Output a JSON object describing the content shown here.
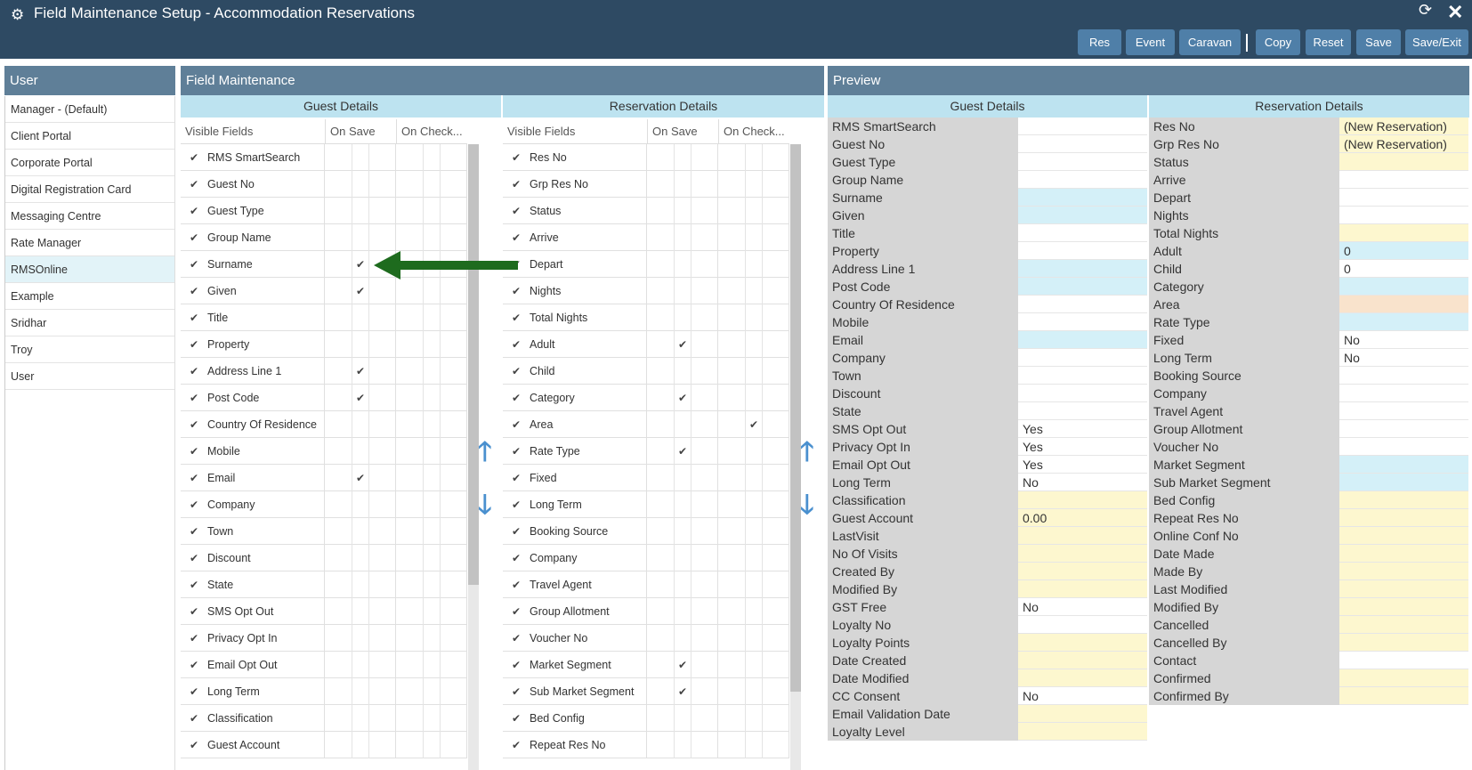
{
  "window": {
    "title": "Field Maintenance Setup - Accommodation Reservations",
    "icon": "gears-icon",
    "refresh_icon": "refresh-icon",
    "close_icon": "close-icon"
  },
  "toolbar": {
    "res": "Res",
    "event": "Event",
    "caravan": "Caravan",
    "copy": "Copy",
    "reset": "Reset",
    "save": "Save",
    "save_exit": "Save/Exit"
  },
  "user_panel": {
    "title": "User",
    "items": [
      "Manager - (Default)",
      "Client Portal",
      "Corporate Portal",
      "Digital Registration Card",
      "Messaging Centre",
      "Rate Manager",
      "RMSOnline",
      "Example",
      "Sridhar",
      "Troy",
      "User"
    ],
    "selected": "RMSOnline"
  },
  "field_maintenance": {
    "title": "Field Maintenance",
    "guest": {
      "title": "Guest Details",
      "col_visible": "Visible Fields",
      "col_on_save": "On Save",
      "col_on_checkin": "On Check...",
      "rows": [
        {
          "name": "RMS SmartSearch",
          "visible": true,
          "save": false,
          "checkin": false
        },
        {
          "name": "Guest No",
          "visible": true,
          "save": false,
          "checkin": false
        },
        {
          "name": "Guest Type",
          "visible": true,
          "save": false,
          "checkin": false
        },
        {
          "name": "Group Name",
          "visible": true,
          "save": false,
          "checkin": false
        },
        {
          "name": "Surname",
          "visible": true,
          "save": true,
          "checkin": false
        },
        {
          "name": "Given",
          "visible": true,
          "save": true,
          "checkin": false
        },
        {
          "name": "Title",
          "visible": true,
          "save": false,
          "checkin": false
        },
        {
          "name": "Property",
          "visible": true,
          "save": false,
          "checkin": false
        },
        {
          "name": "Address Line 1",
          "visible": true,
          "save": true,
          "checkin": false
        },
        {
          "name": "Post Code",
          "visible": true,
          "save": true,
          "checkin": false
        },
        {
          "name": "Country Of Residence",
          "visible": true,
          "save": false,
          "checkin": false
        },
        {
          "name": "Mobile",
          "visible": true,
          "save": false,
          "checkin": false
        },
        {
          "name": "Email",
          "visible": true,
          "save": true,
          "checkin": false
        },
        {
          "name": "Company",
          "visible": true,
          "save": false,
          "checkin": false
        },
        {
          "name": "Town",
          "visible": true,
          "save": false,
          "checkin": false
        },
        {
          "name": "Discount",
          "visible": true,
          "save": false,
          "checkin": false
        },
        {
          "name": "State",
          "visible": true,
          "save": false,
          "checkin": false
        },
        {
          "name": "SMS Opt Out",
          "visible": true,
          "save": false,
          "checkin": false
        },
        {
          "name": "Privacy Opt In",
          "visible": true,
          "save": false,
          "checkin": false
        },
        {
          "name": "Email Opt Out",
          "visible": true,
          "save": false,
          "checkin": false
        },
        {
          "name": "Long Term",
          "visible": true,
          "save": false,
          "checkin": false
        },
        {
          "name": "Classification",
          "visible": true,
          "save": false,
          "checkin": false
        },
        {
          "name": "Guest Account",
          "visible": true,
          "save": false,
          "checkin": false
        }
      ]
    },
    "reservation": {
      "title": "Reservation Details",
      "col_visible": "Visible Fields",
      "col_on_save": "On Save",
      "col_on_checkin": "On Check...",
      "rows": [
        {
          "name": "Res No",
          "visible": true,
          "save": false,
          "checkin": false
        },
        {
          "name": "Grp Res No",
          "visible": true,
          "save": false,
          "checkin": false
        },
        {
          "name": "Status",
          "visible": true,
          "save": false,
          "checkin": false
        },
        {
          "name": "Arrive",
          "visible": true,
          "save": false,
          "checkin": false
        },
        {
          "name": "Depart",
          "visible": true,
          "save": false,
          "checkin": false
        },
        {
          "name": "Nights",
          "visible": true,
          "save": false,
          "checkin": false
        },
        {
          "name": "Total Nights",
          "visible": true,
          "save": false,
          "checkin": false
        },
        {
          "name": "Adult",
          "visible": true,
          "save": true,
          "checkin": false
        },
        {
          "name": "Child",
          "visible": true,
          "save": false,
          "checkin": false
        },
        {
          "name": "Category",
          "visible": true,
          "save": true,
          "checkin": false
        },
        {
          "name": "Area",
          "visible": true,
          "save": false,
          "checkin": true
        },
        {
          "name": "Rate Type",
          "visible": true,
          "save": true,
          "checkin": false
        },
        {
          "name": "Fixed",
          "visible": true,
          "save": false,
          "checkin": false
        },
        {
          "name": "Long Term",
          "visible": true,
          "save": false,
          "checkin": false
        },
        {
          "name": "Booking Source",
          "visible": true,
          "save": false,
          "checkin": false
        },
        {
          "name": "Company",
          "visible": true,
          "save": false,
          "checkin": false
        },
        {
          "name": "Travel Agent",
          "visible": true,
          "save": false,
          "checkin": false
        },
        {
          "name": "Group Allotment",
          "visible": true,
          "save": false,
          "checkin": false
        },
        {
          "name": "Voucher No",
          "visible": true,
          "save": false,
          "checkin": false
        },
        {
          "name": "Market Segment",
          "visible": true,
          "save": true,
          "checkin": false
        },
        {
          "name": "Sub Market Segment",
          "visible": true,
          "save": true,
          "checkin": false
        },
        {
          "name": "Bed Config",
          "visible": true,
          "save": false,
          "checkin": false
        },
        {
          "name": "Repeat Res No",
          "visible": true,
          "save": false,
          "checkin": false
        }
      ]
    }
  },
  "preview": {
    "title": "Preview",
    "guest": {
      "title": "Guest Details",
      "rows": [
        {
          "label": "RMS SmartSearch",
          "value": "",
          "color": "#ffffff"
        },
        {
          "label": "Guest No",
          "value": "",
          "color": "#ffffff"
        },
        {
          "label": "Guest Type",
          "value": "",
          "color": "#ffffff"
        },
        {
          "label": "Group Name",
          "value": "",
          "color": "#ffffff"
        },
        {
          "label": "Surname",
          "value": "",
          "color": "#d4f0f8"
        },
        {
          "label": "Given",
          "value": "",
          "color": "#d4f0f8"
        },
        {
          "label": "Title",
          "value": "",
          "color": "#ffffff"
        },
        {
          "label": "Property",
          "value": "",
          "color": "#ffffff"
        },
        {
          "label": "Address Line 1",
          "value": "",
          "color": "#d4f0f8"
        },
        {
          "label": "Post Code",
          "value": "",
          "color": "#d4f0f8"
        },
        {
          "label": "Country Of Residence",
          "value": "",
          "color": "#ffffff"
        },
        {
          "label": "Mobile",
          "value": "",
          "color": "#ffffff"
        },
        {
          "label": "Email",
          "value": "",
          "color": "#d4f0f8"
        },
        {
          "label": "Company",
          "value": "",
          "color": "#ffffff"
        },
        {
          "label": "Town",
          "value": "",
          "color": "#ffffff"
        },
        {
          "label": "Discount",
          "value": "",
          "color": "#ffffff"
        },
        {
          "label": "State",
          "value": "",
          "color": "#ffffff"
        },
        {
          "label": "SMS Opt Out",
          "value": "Yes",
          "color": "#ffffff"
        },
        {
          "label": "Privacy Opt In",
          "value": "Yes",
          "color": "#ffffff"
        },
        {
          "label": "Email Opt Out",
          "value": "Yes",
          "color": "#ffffff"
        },
        {
          "label": "Long Term",
          "value": "No",
          "color": "#ffffff"
        },
        {
          "label": "Classification",
          "value": "",
          "color": "#fdf7cf"
        },
        {
          "label": "Guest Account",
          "value": "0.00",
          "color": "#fdf7cf"
        },
        {
          "label": "LastVisit",
          "value": "",
          "color": "#fdf7cf"
        },
        {
          "label": "No Of Visits",
          "value": "",
          "color": "#fdf7cf"
        },
        {
          "label": "Created By",
          "value": "",
          "color": "#fdf7cf"
        },
        {
          "label": "Modified By",
          "value": "",
          "color": "#fdf7cf"
        },
        {
          "label": "GST Free",
          "value": "No",
          "color": "#ffffff"
        },
        {
          "label": "Loyalty No",
          "value": "",
          "color": "#ffffff"
        },
        {
          "label": "Loyalty Points",
          "value": "",
          "color": "#fdf7cf"
        },
        {
          "label": "Date Created",
          "value": "",
          "color": "#fdf7cf"
        },
        {
          "label": "Date Modified",
          "value": "",
          "color": "#fdf7cf"
        },
        {
          "label": "CC Consent",
          "value": "No",
          "color": "#ffffff"
        },
        {
          "label": "Email Validation Date",
          "value": "",
          "color": "#fdf7cf"
        },
        {
          "label": "Loyalty Level",
          "value": "",
          "color": "#fdf7cf"
        }
      ]
    },
    "reservation": {
      "title": "Reservation Details",
      "rows": [
        {
          "label": "Res No",
          "value": "(New Reservation)",
          "color": "#fdf7cf"
        },
        {
          "label": "Grp Res No",
          "value": "(New Reservation)",
          "color": "#fdf7cf"
        },
        {
          "label": "Status",
          "value": "",
          "color": "#fdf7cf"
        },
        {
          "label": "Arrive",
          "value": "",
          "color": "#ffffff"
        },
        {
          "label": "Depart",
          "value": "",
          "color": "#ffffff"
        },
        {
          "label": "Nights",
          "value": "",
          "color": "#ffffff"
        },
        {
          "label": "Total Nights",
          "value": "",
          "color": "#fdf7cf"
        },
        {
          "label": "Adult",
          "value": "0",
          "color": "#d4f0f8"
        },
        {
          "label": "Child",
          "value": "0",
          "color": "#ffffff"
        },
        {
          "label": "Category",
          "value": "",
          "color": "#d4f0f8"
        },
        {
          "label": "Area",
          "value": "",
          "color": "#f9e3cc"
        },
        {
          "label": "Rate Type",
          "value": "",
          "color": "#d4f0f8"
        },
        {
          "label": "Fixed",
          "value": "No",
          "color": "#ffffff"
        },
        {
          "label": "Long Term",
          "value": "No",
          "color": "#ffffff"
        },
        {
          "label": "Booking Source",
          "value": "",
          "color": "#ffffff"
        },
        {
          "label": "Company",
          "value": "",
          "color": "#ffffff"
        },
        {
          "label": "Travel Agent",
          "value": "",
          "color": "#ffffff"
        },
        {
          "label": "Group Allotment",
          "value": "",
          "color": "#ffffff"
        },
        {
          "label": "Voucher No",
          "value": "",
          "color": "#ffffff"
        },
        {
          "label": "Market Segment",
          "value": "",
          "color": "#d4f0f8"
        },
        {
          "label": "Sub Market Segment",
          "value": "",
          "color": "#d4f0f8"
        },
        {
          "label": "Bed Config",
          "value": "",
          "color": "#fdf7cf"
        },
        {
          "label": "Repeat Res No",
          "value": "",
          "color": "#fdf7cf"
        },
        {
          "label": "Online Conf No",
          "value": "",
          "color": "#fdf7cf"
        },
        {
          "label": "Date Made",
          "value": "",
          "color": "#fdf7cf"
        },
        {
          "label": "Made By",
          "value": "",
          "color": "#fdf7cf"
        },
        {
          "label": "Last Modified",
          "value": "",
          "color": "#fdf7cf"
        },
        {
          "label": "Modified By",
          "value": "",
          "color": "#fdf7cf"
        },
        {
          "label": "Cancelled",
          "value": "",
          "color": "#fdf7cf"
        },
        {
          "label": "Cancelled By",
          "value": "",
          "color": "#fdf7cf"
        },
        {
          "label": "Contact",
          "value": "",
          "color": "#ffffff"
        },
        {
          "label": "Confirmed",
          "value": "",
          "color": "#fdf7cf"
        },
        {
          "label": "Confirmed By",
          "value": "",
          "color": "#fdf7cf"
        }
      ]
    }
  },
  "colors": {
    "titlebar": "#2e4a63",
    "button": "#4f7fa8",
    "panel_header": "#5f7f98",
    "sub_header": "#bde3f0",
    "annotation_arrow": "#1e6b1e"
  }
}
